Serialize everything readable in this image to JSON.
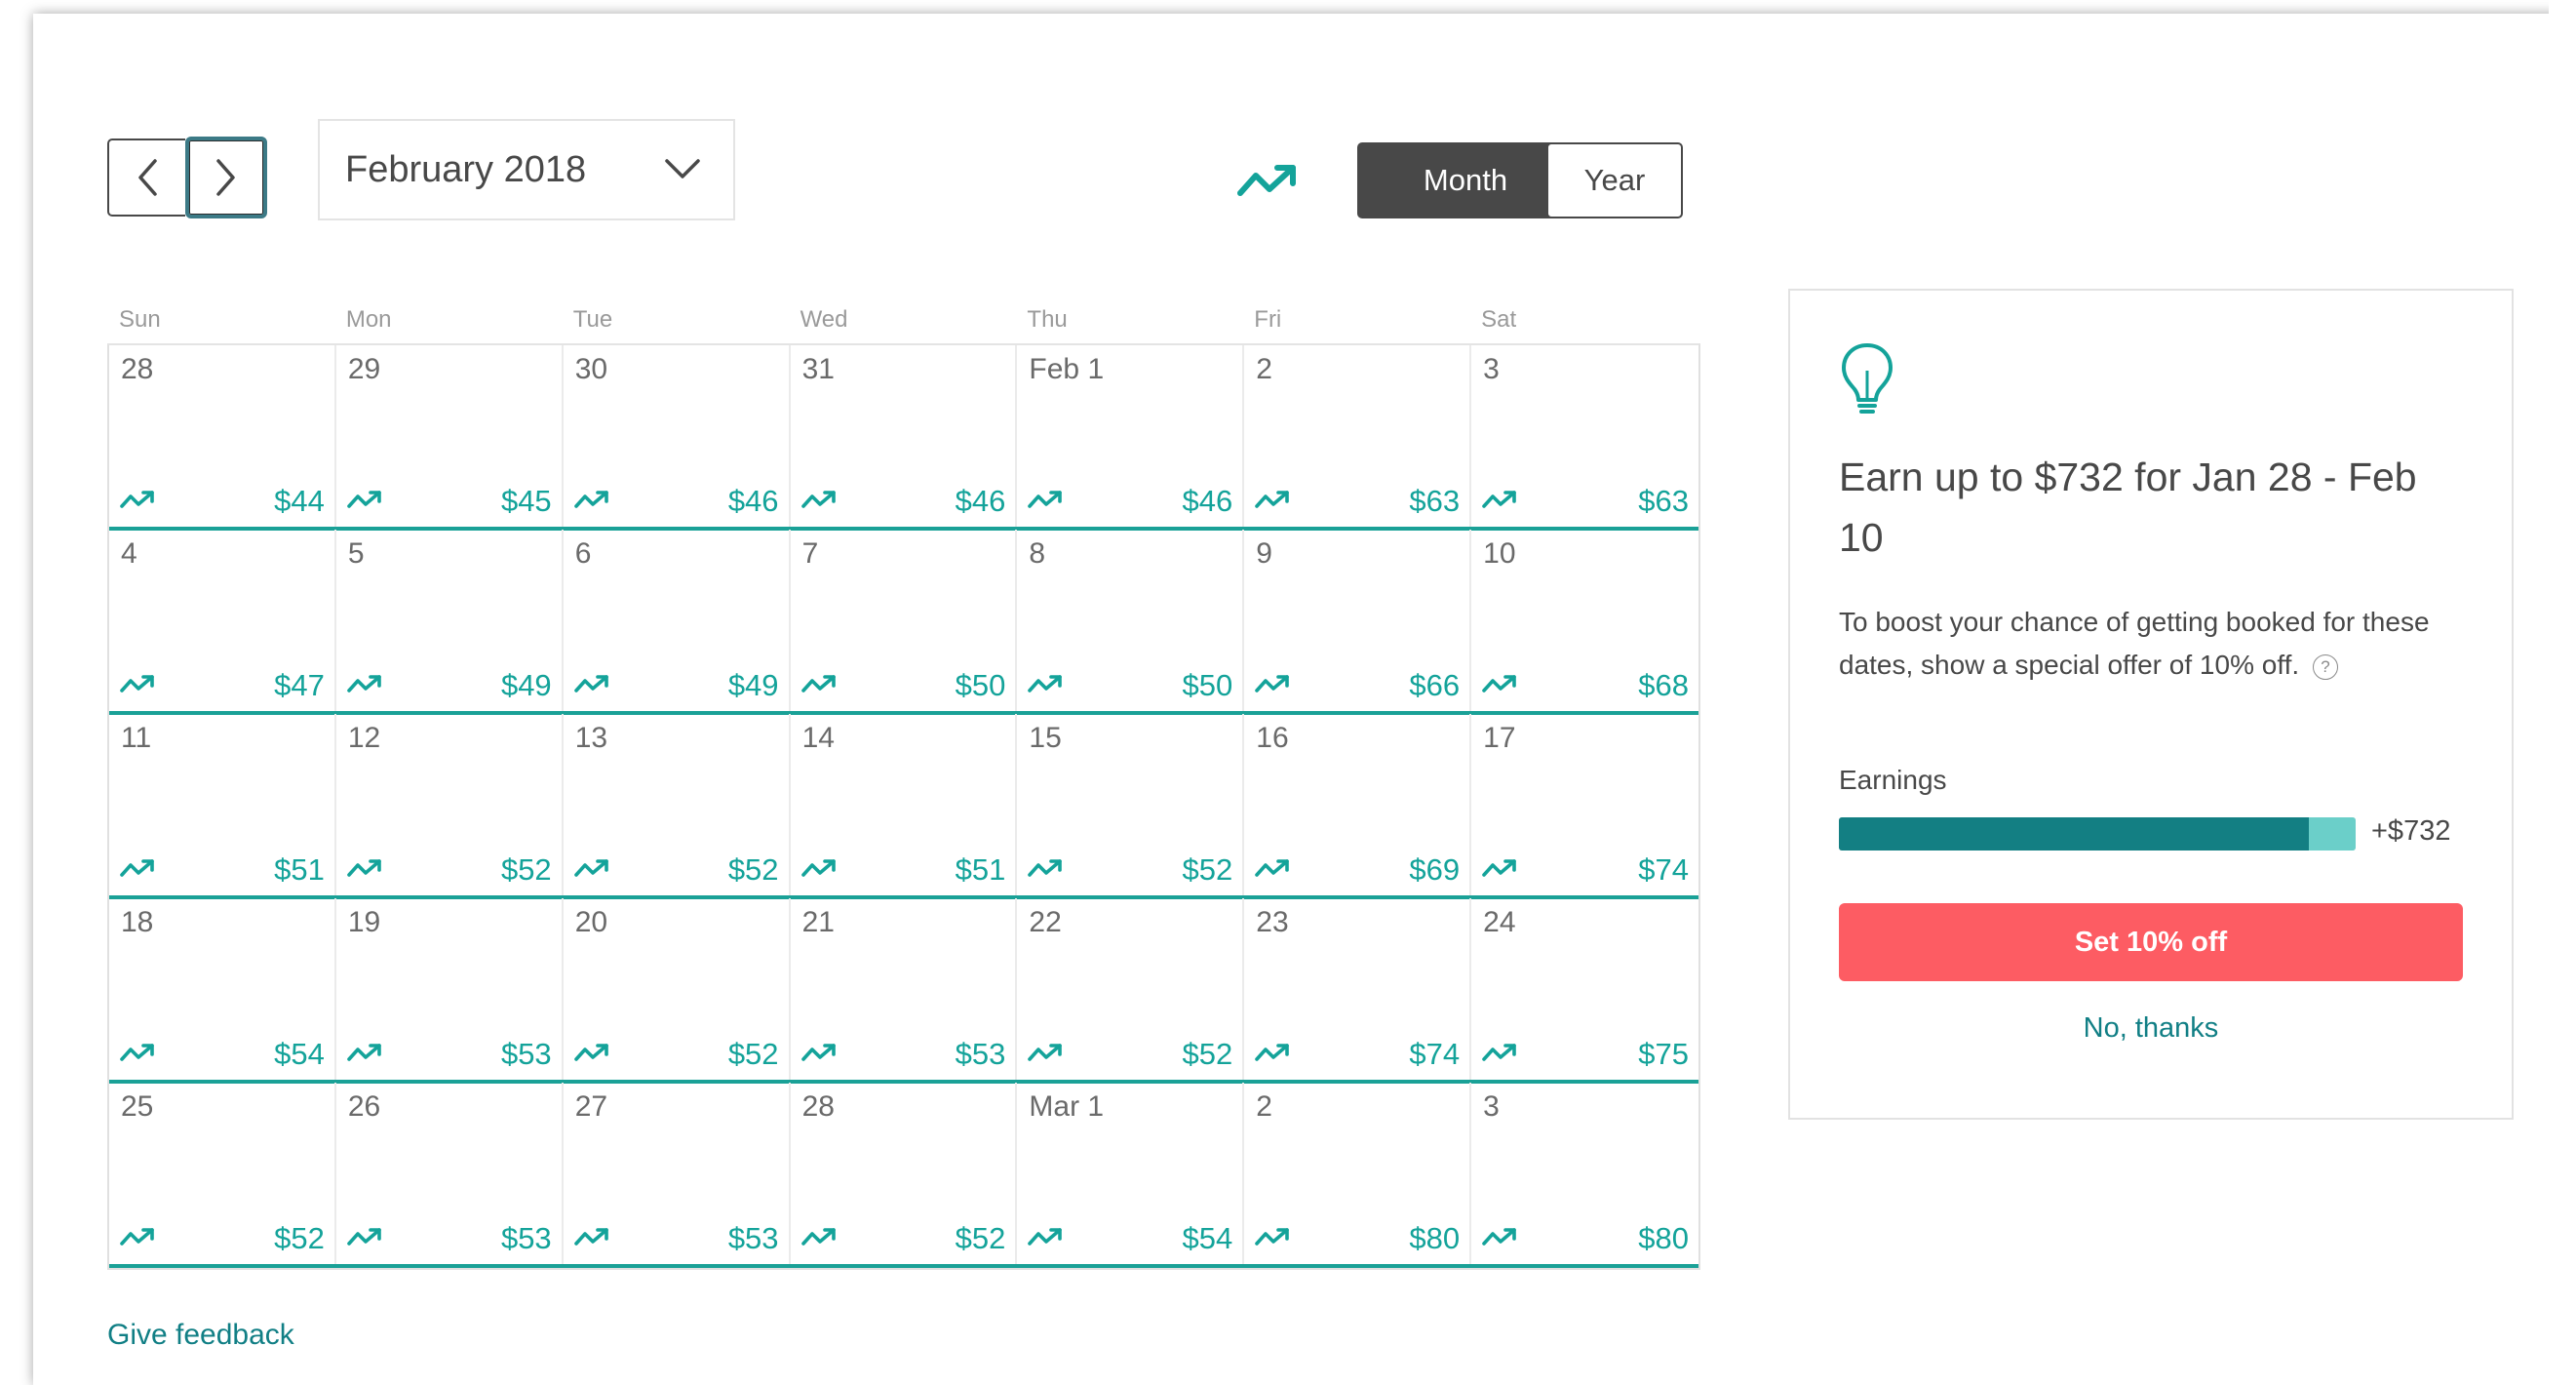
{
  "toolbar": {
    "month_selector": "February 2018",
    "view_month": "Month",
    "view_year": "Year"
  },
  "calendar": {
    "weekdays": [
      "Sun",
      "Mon",
      "Tue",
      "Wed",
      "Thu",
      "Fri",
      "Sat"
    ],
    "weeks": [
      [
        {
          "day": "28",
          "price": "$44"
        },
        {
          "day": "29",
          "price": "$45"
        },
        {
          "day": "30",
          "price": "$46"
        },
        {
          "day": "31",
          "price": "$46"
        },
        {
          "day": "Feb 1",
          "price": "$46"
        },
        {
          "day": "2",
          "price": "$63"
        },
        {
          "day": "3",
          "price": "$63"
        }
      ],
      [
        {
          "day": "4",
          "price": "$47"
        },
        {
          "day": "5",
          "price": "$49"
        },
        {
          "day": "6",
          "price": "$49"
        },
        {
          "day": "7",
          "price": "$50"
        },
        {
          "day": "8",
          "price": "$50"
        },
        {
          "day": "9",
          "price": "$66"
        },
        {
          "day": "10",
          "price": "$68"
        }
      ],
      [
        {
          "day": "11",
          "price": "$51"
        },
        {
          "day": "12",
          "price": "$52"
        },
        {
          "day": "13",
          "price": "$52"
        },
        {
          "day": "14",
          "price": "$51"
        },
        {
          "day": "15",
          "price": "$52"
        },
        {
          "day": "16",
          "price": "$69"
        },
        {
          "day": "17",
          "price": "$74"
        }
      ],
      [
        {
          "day": "18",
          "price": "$54"
        },
        {
          "day": "19",
          "price": "$53"
        },
        {
          "day": "20",
          "price": "$52"
        },
        {
          "day": "21",
          "price": "$53"
        },
        {
          "day": "22",
          "price": "$52"
        },
        {
          "day": "23",
          "price": "$74"
        },
        {
          "day": "24",
          "price": "$75"
        }
      ],
      [
        {
          "day": "25",
          "price": "$52"
        },
        {
          "day": "26",
          "price": "$53"
        },
        {
          "day": "27",
          "price": "$53"
        },
        {
          "day": "28",
          "price": "$52"
        },
        {
          "day": "Mar 1",
          "price": "$54"
        },
        {
          "day": "2",
          "price": "$80"
        },
        {
          "day": "3",
          "price": "$80"
        }
      ]
    ],
    "feedback": "Give feedback"
  },
  "offer": {
    "title": "Earn up to $732 for Jan 28 - Feb 10",
    "body": "To boost your chance of getting booked for these dates, show a special offer of 10% off.",
    "help_icon": "?",
    "earnings_label": "Earnings",
    "earnings_base_fraction": 0.91,
    "earnings_extra_fraction": 0.09,
    "earnings_value": "+$732",
    "cta": "Set 10% off",
    "decline": "No, thanks"
  },
  "colors": {
    "teal": "#14a39a",
    "dark_teal": "#137f83",
    "light_teal": "#6bcfc9",
    "coral": "#fd5c63",
    "dark": "#484848"
  },
  "icons": {
    "prev": "chevron-left-icon",
    "next": "chevron-right-icon",
    "dropdown": "chevron-down-icon",
    "trend": "trending-up-icon",
    "tip": "lightbulb-icon",
    "help": "question-circle-icon"
  }
}
